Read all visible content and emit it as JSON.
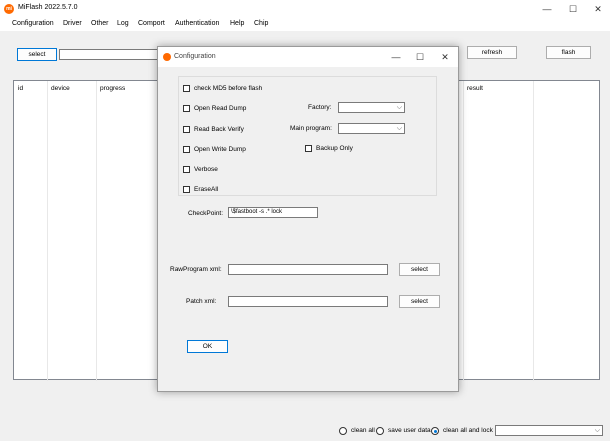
{
  "app": {
    "logo_text": "mi",
    "title": "MiFlash 2022.5.7.0"
  },
  "window_controls": {
    "minimize": "—",
    "maximize": "☐",
    "close": "✕"
  },
  "menu": [
    "Configuration",
    "Driver",
    "Other",
    "Log",
    "Comport",
    "Authentication",
    "Help",
    "Chip"
  ],
  "toolbar": {
    "select_label": "select",
    "path_value": "",
    "refresh_label": "refresh",
    "flash_label": "flash"
  },
  "table": {
    "columns": [
      "id",
      "device",
      "progress",
      "result"
    ]
  },
  "bottom": {
    "options": [
      {
        "label": "clean all",
        "checked": false
      },
      {
        "label": "save user data",
        "checked": false
      },
      {
        "label": "clean all and lock",
        "checked": true
      }
    ],
    "combo_value": ""
  },
  "dialog": {
    "title": "Configuration",
    "checkboxes": {
      "check_md5": "check MD5 before flash",
      "open_read_dump": "Open Read Dump",
      "read_back_verify": "Read Back Verify",
      "open_write_dump": "Open Write Dump",
      "verbose": "Verbose",
      "erase_all": "EraseAll",
      "backup_only": "Backup Only"
    },
    "factory_label": "Factory:",
    "factory_value": "",
    "main_program_label": "Main program:",
    "main_program_value": "",
    "checkpoint_label": "CheckPoint:",
    "checkpoint_value": "\\$fastboot -s .* lock",
    "rawprogram_label": "RawProgram xml:",
    "rawprogram_value": "",
    "rawprogram_select": "select",
    "patch_label": "Patch xml:",
    "patch_value": "",
    "patch_select": "select",
    "ok_label": "OK"
  }
}
